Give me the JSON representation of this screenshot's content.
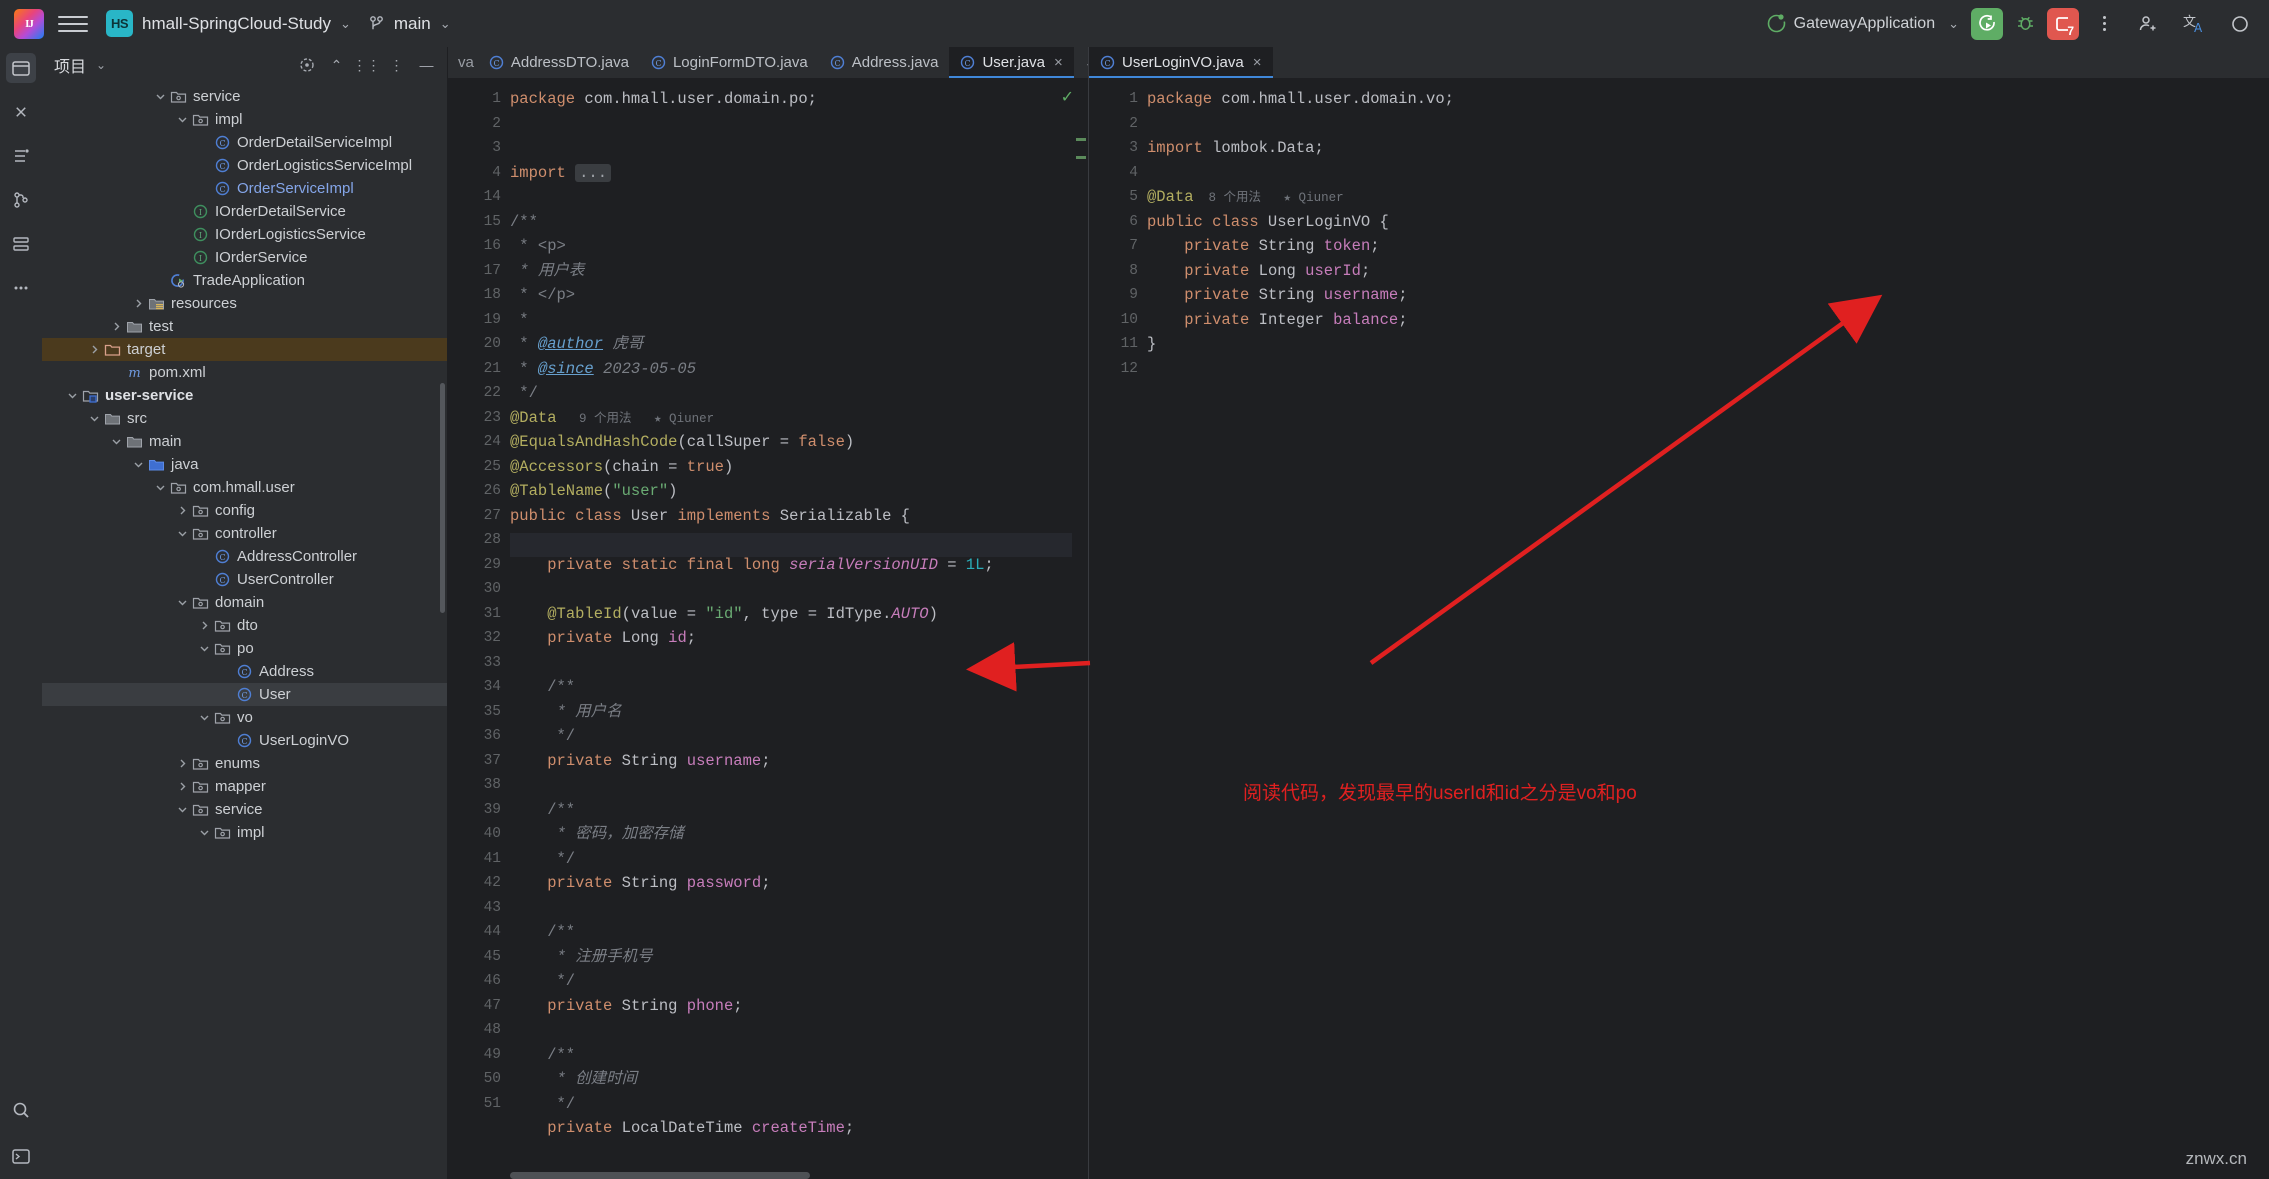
{
  "toolbar": {
    "logo_text": "IJ",
    "project_name": "hmall-SpringCloud-Study",
    "project_badge": "HS",
    "branch": "main",
    "run_config": "GatewayApplication",
    "chevron": "⌄",
    "notification_count": "7",
    "icons": {
      "hamburger": "main-menu-icon",
      "run": "run-icon",
      "debug": "debug-icon",
      "stop": "services-icon",
      "more": "more-options-icon",
      "share": "share-icon",
      "translate": "translate-icon",
      "settings": "settings-icon"
    }
  },
  "project_panel": {
    "title": "项目",
    "chevron": "⌄",
    "actions": [
      "select-opened-file-icon",
      "expand-all-icon",
      "collapse-all-icon",
      "options-icon",
      "hide-icon"
    ],
    "tree": [
      {
        "label": "service",
        "indent": 5,
        "arrow": "down",
        "icon": "package",
        "style": "plain"
      },
      {
        "label": "impl",
        "indent": 6,
        "arrow": "down",
        "icon": "package",
        "style": "plain"
      },
      {
        "label": "OrderDetailServiceImpl",
        "indent": 7,
        "arrow": "none",
        "icon": "class",
        "style": "plain"
      },
      {
        "label": "OrderLogisticsServiceImpl",
        "indent": 7,
        "arrow": "none",
        "icon": "class",
        "style": "plain"
      },
      {
        "label": "OrderServiceImpl",
        "indent": 7,
        "arrow": "none",
        "icon": "class",
        "style": "blue"
      },
      {
        "label": "IOrderDetailService",
        "indent": 6,
        "arrow": "none",
        "icon": "interface",
        "style": "plain"
      },
      {
        "label": "IOrderLogisticsService",
        "indent": 6,
        "arrow": "none",
        "icon": "interface",
        "style": "plain"
      },
      {
        "label": "IOrderService",
        "indent": 6,
        "arrow": "none",
        "icon": "interface",
        "style": "plain"
      },
      {
        "label": "TradeApplication",
        "indent": 5,
        "arrow": "none",
        "icon": "springboot",
        "style": "plain"
      },
      {
        "label": "resources",
        "indent": 4,
        "arrow": "right",
        "icon": "resources",
        "style": "plain"
      },
      {
        "label": "test",
        "indent": 3,
        "arrow": "right",
        "icon": "folder",
        "style": "plain"
      },
      {
        "label": "target",
        "indent": 2,
        "arrow": "right",
        "icon": "folder-excluded",
        "style": "plain",
        "row": "orange"
      },
      {
        "label": "pom.xml",
        "indent": 3,
        "arrow": "none",
        "icon": "maven",
        "style": "plain"
      },
      {
        "label": "user-service",
        "indent": 1,
        "arrow": "down",
        "icon": "module",
        "style": "bold"
      },
      {
        "label": "src",
        "indent": 2,
        "arrow": "down",
        "icon": "folder",
        "style": "plain"
      },
      {
        "label": "main",
        "indent": 3,
        "arrow": "down",
        "icon": "folder",
        "style": "plain"
      },
      {
        "label": "java",
        "indent": 4,
        "arrow": "down",
        "icon": "source-root",
        "style": "plain"
      },
      {
        "label": "com.hmall.user",
        "indent": 5,
        "arrow": "down",
        "icon": "package",
        "style": "plain"
      },
      {
        "label": "config",
        "indent": 6,
        "arrow": "right",
        "icon": "package",
        "style": "plain"
      },
      {
        "label": "controller",
        "indent": 6,
        "arrow": "down",
        "icon": "package",
        "style": "plain"
      },
      {
        "label": "AddressController",
        "indent": 7,
        "arrow": "none",
        "icon": "class",
        "style": "plain"
      },
      {
        "label": "UserController",
        "indent": 7,
        "arrow": "none",
        "icon": "class",
        "style": "plain"
      },
      {
        "label": "domain",
        "indent": 6,
        "arrow": "down",
        "icon": "package",
        "style": "plain"
      },
      {
        "label": "dto",
        "indent": 7,
        "arrow": "right",
        "icon": "package",
        "style": "plain"
      },
      {
        "label": "po",
        "indent": 7,
        "arrow": "down",
        "icon": "package",
        "style": "plain"
      },
      {
        "label": "Address",
        "indent": 8,
        "arrow": "none",
        "icon": "class",
        "style": "plain"
      },
      {
        "label": "User",
        "indent": 8,
        "arrow": "none",
        "icon": "class",
        "style": "plain",
        "row": "blue"
      },
      {
        "label": "vo",
        "indent": 7,
        "arrow": "down",
        "icon": "package",
        "style": "plain"
      },
      {
        "label": "UserLoginVO",
        "indent": 8,
        "arrow": "none",
        "icon": "class",
        "style": "plain"
      },
      {
        "label": "enums",
        "indent": 6,
        "arrow": "right",
        "icon": "package",
        "style": "plain"
      },
      {
        "label": "mapper",
        "indent": 6,
        "arrow": "right",
        "icon": "package",
        "style": "plain"
      },
      {
        "label": "service",
        "indent": 6,
        "arrow": "down",
        "icon": "package",
        "style": "plain"
      },
      {
        "label": "impl",
        "indent": 7,
        "arrow": "down",
        "icon": "package",
        "style": "plain"
      }
    ]
  },
  "editor_left": {
    "partial_tab": "va",
    "tabs": [
      {
        "label": "AddressDTO.java",
        "active": false,
        "closable": false
      },
      {
        "label": "LoginFormDTO.java",
        "active": false,
        "closable": false
      },
      {
        "label": "Address.java",
        "active": false,
        "closable": false
      },
      {
        "label": "User.java",
        "active": true,
        "closable": true
      }
    ],
    "tab_end": {
      "chevron": "⌄",
      "kebab": "more-tabs-icon"
    },
    "gutter": [
      "1",
      "2",
      "3",
      "4",
      "14",
      "15",
      "16",
      "17",
      "18",
      "19",
      "20",
      "21",
      "22",
      "23",
      "24",
      "25",
      "26",
      "27",
      "28",
      "29",
      "30",
      "31",
      "32",
      "33",
      "34",
      "35",
      "36",
      "37",
      "38",
      "39",
      "40",
      "41",
      "42",
      "43",
      "44",
      "45",
      "46",
      "47",
      "48",
      "49",
      "50",
      "51"
    ],
    "inspection_status": "✓",
    "code_lines": [
      {
        "t": "package",
        "segs": [
          [
            "kw",
            "package "
          ],
          [
            "typ",
            "com.hmall.user.domain.po;"
          ]
        ]
      },
      {
        "t": "blank",
        "segs": []
      },
      {
        "t": "blank",
        "segs": []
      },
      {
        "t": "import",
        "segs": [
          [
            "kw",
            "import "
          ],
          [
            "fold",
            "..."
          ]
        ]
      },
      {
        "t": "blank",
        "segs": []
      },
      {
        "t": "cmt",
        "segs": [
          [
            "cmt",
            "/**"
          ]
        ]
      },
      {
        "t": "cmt",
        "segs": [
          [
            "cmt",
            " * <p>"
          ]
        ]
      },
      {
        "t": "cmt",
        "segs": [
          [
            "cmt-i",
            " * 用户表"
          ]
        ]
      },
      {
        "t": "cmt",
        "segs": [
          [
            "cmt",
            " * </p>"
          ]
        ]
      },
      {
        "t": "cmt",
        "segs": [
          [
            "cmt",
            " *"
          ]
        ]
      },
      {
        "t": "cmt",
        "segs": [
          [
            "cmt",
            " * "
          ],
          [
            "doc-tag",
            "@author"
          ],
          [
            "cmt-i",
            " 虎哥"
          ]
        ]
      },
      {
        "t": "cmt",
        "segs": [
          [
            "cmt",
            " * "
          ],
          [
            "doc-tag",
            "@since"
          ],
          [
            "cmt-i",
            " 2023-05-05"
          ]
        ]
      },
      {
        "t": "cmt",
        "segs": [
          [
            "cmt",
            " */"
          ]
        ]
      },
      {
        "t": "ann",
        "segs": [
          [
            "ann",
            "@Data"
          ],
          [
            "usage",
            "   9 个用法"
          ],
          [
            "usage",
            "   ★ Qiuner"
          ]
        ]
      },
      {
        "t": "ann",
        "segs": [
          [
            "ann",
            "@EqualsAndHashCode"
          ],
          [
            "typ",
            "(callSuper = "
          ],
          [
            "kw",
            "false"
          ],
          [
            "typ",
            ")"
          ]
        ]
      },
      {
        "t": "ann",
        "segs": [
          [
            "ann",
            "@Accessors"
          ],
          [
            "typ",
            "(chain = "
          ],
          [
            "kw",
            "true"
          ],
          [
            "typ",
            ")"
          ]
        ]
      },
      {
        "t": "ann",
        "segs": [
          [
            "ann",
            "@TableName"
          ],
          [
            "typ",
            "("
          ],
          [
            "str",
            "\"user\""
          ],
          [
            "typ",
            ")"
          ]
        ]
      },
      {
        "t": "code",
        "segs": [
          [
            "kw",
            "public class "
          ],
          [
            "typ",
            "User "
          ],
          [
            "kw",
            "implements "
          ],
          [
            "typ",
            "Serializable {"
          ]
        ]
      },
      {
        "t": "blank",
        "segs": []
      },
      {
        "t": "code",
        "segs": [
          [
            "typ",
            "    "
          ],
          [
            "kw",
            "private static final long "
          ],
          [
            "cnst",
            "serialVersionUID"
          ],
          [
            "typ",
            " = "
          ],
          [
            "num",
            "1L"
          ],
          [
            "typ",
            ";"
          ]
        ]
      },
      {
        "t": "blank",
        "segs": []
      },
      {
        "t": "code",
        "segs": [
          [
            "typ",
            "    "
          ],
          [
            "ann",
            "@TableId"
          ],
          [
            "typ",
            "(value = "
          ],
          [
            "str",
            "\"id\""
          ],
          [
            "typ",
            ", type = IdType."
          ],
          [
            "cnst",
            "AUTO"
          ],
          [
            "typ",
            ")"
          ]
        ]
      },
      {
        "t": "code",
        "segs": [
          [
            "typ",
            "    "
          ],
          [
            "kw",
            "private "
          ],
          [
            "typ",
            "Long "
          ],
          [
            "fld",
            "id"
          ],
          [
            "typ",
            ";"
          ]
        ]
      },
      {
        "t": "blank",
        "segs": []
      },
      {
        "t": "cmt",
        "segs": [
          [
            "cmt",
            "    /**"
          ]
        ]
      },
      {
        "t": "cmt",
        "segs": [
          [
            "cmt-i",
            "     * 用户名"
          ]
        ]
      },
      {
        "t": "cmt",
        "segs": [
          [
            "cmt",
            "     */"
          ]
        ]
      },
      {
        "t": "code",
        "segs": [
          [
            "typ",
            "    "
          ],
          [
            "kw",
            "private "
          ],
          [
            "typ",
            "String "
          ],
          [
            "fld",
            "username"
          ],
          [
            "typ",
            ";"
          ]
        ]
      },
      {
        "t": "blank",
        "segs": []
      },
      {
        "t": "cmt",
        "segs": [
          [
            "cmt",
            "    /**"
          ]
        ]
      },
      {
        "t": "cmt",
        "segs": [
          [
            "cmt-i",
            "     * 密码，加密存储"
          ]
        ]
      },
      {
        "t": "cmt",
        "segs": [
          [
            "cmt",
            "     */"
          ]
        ]
      },
      {
        "t": "code",
        "segs": [
          [
            "typ",
            "    "
          ],
          [
            "kw",
            "private "
          ],
          [
            "typ",
            "String "
          ],
          [
            "fld",
            "password"
          ],
          [
            "typ",
            ";"
          ]
        ]
      },
      {
        "t": "blank",
        "segs": []
      },
      {
        "t": "cmt",
        "segs": [
          [
            "cmt",
            "    /**"
          ]
        ]
      },
      {
        "t": "cmt",
        "segs": [
          [
            "cmt-i",
            "     * 注册手机号"
          ]
        ]
      },
      {
        "t": "cmt",
        "segs": [
          [
            "cmt",
            "     */"
          ]
        ]
      },
      {
        "t": "code",
        "segs": [
          [
            "typ",
            "    "
          ],
          [
            "kw",
            "private "
          ],
          [
            "typ",
            "String "
          ],
          [
            "fld",
            "phone"
          ],
          [
            "typ",
            ";"
          ]
        ]
      },
      {
        "t": "blank",
        "segs": []
      },
      {
        "t": "cmt",
        "segs": [
          [
            "cmt",
            "    /**"
          ]
        ]
      },
      {
        "t": "cmt",
        "segs": [
          [
            "cmt-i",
            "     * 创建时间"
          ]
        ]
      },
      {
        "t": "cmt",
        "segs": [
          [
            "cmt",
            "     */"
          ]
        ]
      },
      {
        "t": "code",
        "segs": [
          [
            "typ",
            "    "
          ],
          [
            "kw",
            "private "
          ],
          [
            "typ",
            "LocalDateTime "
          ],
          [
            "fld",
            "createTime"
          ],
          [
            "typ",
            ";"
          ]
        ]
      }
    ]
  },
  "editor_right": {
    "tabs": [
      {
        "label": "UserLoginVO.java",
        "active": true,
        "closable": true
      }
    ],
    "gutter": [
      "1",
      "2",
      "3",
      "4",
      "5",
      "6",
      "7",
      "8",
      "9",
      "10",
      "11",
      "12"
    ],
    "code_lines": [
      {
        "segs": [
          [
            "kw",
            "package "
          ],
          [
            "typ",
            "com.hmall.user.domain.vo;"
          ]
        ]
      },
      {
        "segs": []
      },
      {
        "segs": [
          [
            "kw",
            "import "
          ],
          [
            "typ",
            "lombok.Data;"
          ]
        ]
      },
      {
        "segs": []
      },
      {
        "segs": [
          [
            "ann",
            "@Data"
          ],
          [
            "usage",
            "  8 个用法"
          ],
          [
            "usage",
            "   ★ Qiuner"
          ]
        ]
      },
      {
        "segs": [
          [
            "kw",
            "public class "
          ],
          [
            "typ",
            "UserLoginVO {"
          ]
        ]
      },
      {
        "segs": [
          [
            "typ",
            "    "
          ],
          [
            "kw",
            "private "
          ],
          [
            "typ",
            "String "
          ],
          [
            "fld",
            "token"
          ],
          [
            "typ",
            ";"
          ]
        ]
      },
      {
        "segs": [
          [
            "typ",
            "    "
          ],
          [
            "kw",
            "private "
          ],
          [
            "typ",
            "Long "
          ],
          [
            "fld",
            "userId"
          ],
          [
            "typ",
            ";"
          ]
        ]
      },
      {
        "segs": [
          [
            "typ",
            "    "
          ],
          [
            "kw",
            "private "
          ],
          [
            "typ",
            "String "
          ],
          [
            "fld",
            "username"
          ],
          [
            "typ",
            ";"
          ]
        ]
      },
      {
        "segs": [
          [
            "typ",
            "    "
          ],
          [
            "kw",
            "private "
          ],
          [
            "typ",
            "Integer "
          ],
          [
            "fld",
            "balance"
          ],
          [
            "typ",
            ";"
          ]
        ]
      },
      {
        "segs": [
          [
            "typ",
            "}"
          ]
        ]
      },
      {
        "segs": []
      }
    ]
  },
  "annotations": {
    "note": "阅读代码，发现最早的userId和id之分是vo和po",
    "color": "#e02020",
    "arrows": [
      "arrow-to-userId-field",
      "arrow-to-id-field"
    ]
  },
  "watermark": "znwx.cn"
}
